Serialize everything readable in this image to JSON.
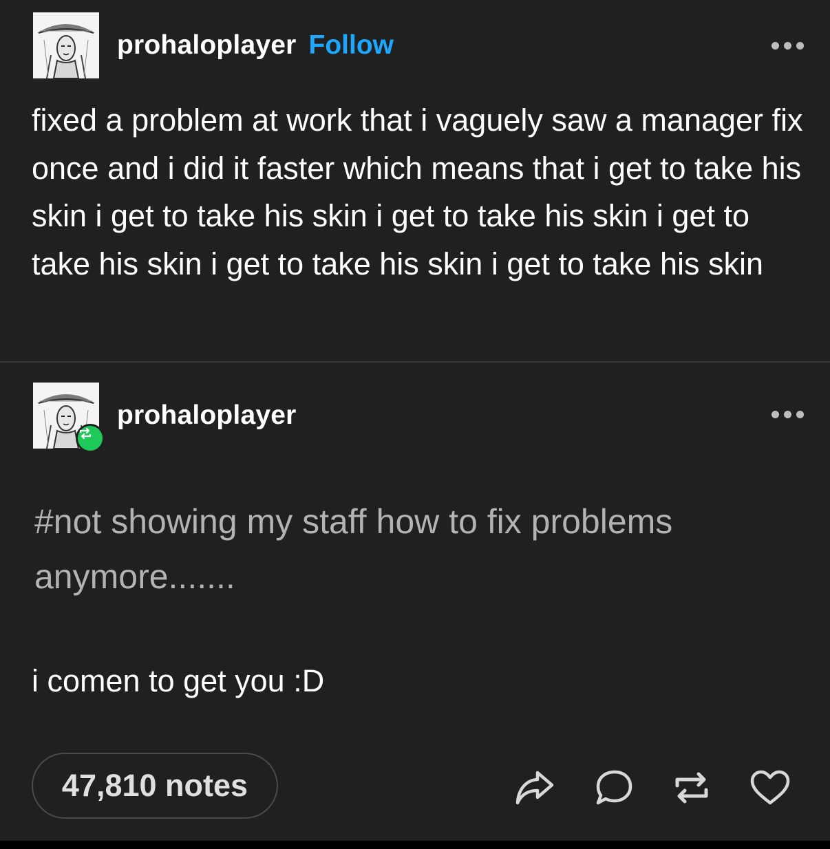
{
  "post": {
    "username": "prohaloplayer",
    "follow_label": "Follow",
    "body": "fixed a problem at work that i vaguely saw a manager fix once and i did it faster which means that i get to take his skin i get to take his skin i get to take his skin i get to take his skin i get to take his skin i get to take his skin"
  },
  "reblog": {
    "username": "prohaloplayer",
    "tags": "#not showing my staff how to fix problems anymore.......",
    "reply": "i comen to get you :D"
  },
  "footer": {
    "notes_label": "47,810 notes"
  },
  "icons": {
    "share": "share-icon",
    "comment": "comment-icon",
    "reblog": "reblog-icon",
    "like": "heart-icon",
    "more": "more-icon",
    "reblog_badge": "reblog-badge-icon"
  },
  "colors": {
    "background": "#202020",
    "follow": "#1ea7ff",
    "tag_text": "#b3b3b3",
    "reblog_badge": "#1ec95a"
  }
}
